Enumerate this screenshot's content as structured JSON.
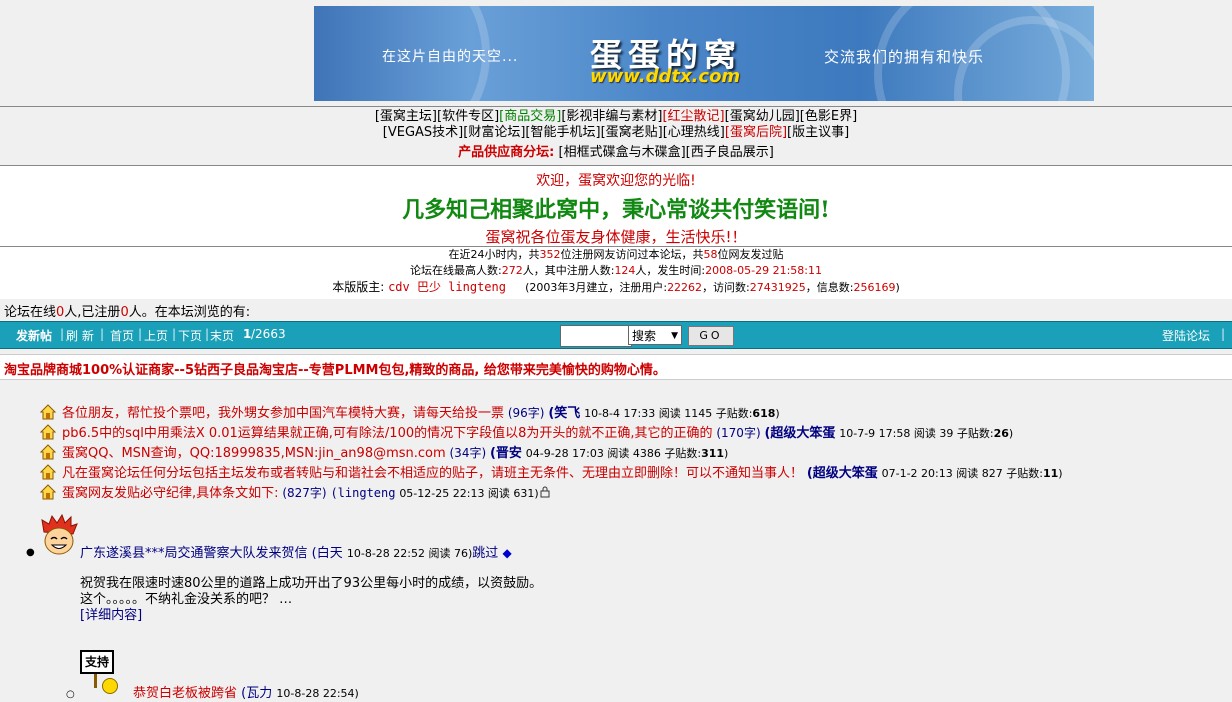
{
  "banner": {
    "left_slogan": "在这片自由的天空...",
    "logo_title": "蛋蛋的窝",
    "logo_url": "www.ddtx.com",
    "right_slogan": "交流我们的拥有和快乐"
  },
  "nav": {
    "row1": [
      "[蛋窝主坛]",
      "[软件专区]",
      "[商品交易]",
      "[影视非编与素材]",
      "[红尘散记]",
      "[蛋窝幼儿园]",
      "[色影E界]"
    ],
    "row2": [
      "[VEGAS技术]",
      "[财富论坛]",
      "[智能手机坛]",
      "[蛋窝老贴]",
      "[心理热线]",
      "[蛋窝后院]",
      "[版主议事]"
    ],
    "supplier_label": "产品供应商分坛:",
    "supplier_links": [
      "[相框式碟盒与木碟盒]",
      "[西子良品展示]"
    ]
  },
  "welcome": {
    "line1": "欢迎，蛋窝欢迎您的光临!",
    "line2": "几多知己相聚此窝中，秉心常谈共付笑语间!",
    "line3": "蛋窝祝各位蛋友身体健康，生活快乐!！"
  },
  "stats": {
    "l1_a": "在近24小时内，共",
    "l1_num1": "352",
    "l1_b": "位注册网友访问过本论坛，共",
    "l1_num2": "58",
    "l1_c": "位网友发过贴",
    "l2_a": "论坛在线最高人数:",
    "l2_num1": "272",
    "l2_b": "人，其中注册人数:",
    "l2_num2": "124",
    "l2_c": "人，发生时间:",
    "l2_time": "2008-05-29 21:58:11",
    "l3_label": "本版版主:",
    "moderators": "cdv 巴少 lingteng",
    "l3_info_a": "(2003年3月建立，注册用户:",
    "reg_users": "22262",
    "l3_info_b": "，访问数:",
    "visits": "27431925",
    "l3_info_c": "，信息数:",
    "messages": "256169",
    "l3_info_d": ")"
  },
  "online": {
    "a": "论坛在线",
    "num1": "0",
    "b": "人,已注册",
    "num2": "0",
    "c": "人。在本坛浏览的有:"
  },
  "toolbar": {
    "new_post": "发新帖",
    "refresh": "刷 新",
    "first": "首页",
    "prev": "上页",
    "next": "下页",
    "last": "末页",
    "page_current": "1",
    "page_total": "/2663",
    "search_placeholder": "",
    "search_select": "搜索",
    "go": "GO",
    "login": "登陆论坛"
  },
  "ad": {
    "text": "淘宝品牌商城100%认证商家--5钻西子良品淘宝店--专营PLMM包包,精致的商品, 给您带来完美愉快的购物心情。"
  },
  "pinned": [
    {
      "title": "各位朋友，帮忙投个票吧，我外甥女参加中国汽车模特大赛，请每天给投一票",
      "count": "(96字)",
      "author": "(笑飞",
      "meta": "10-8-4 17:33 阅读 1145 子贴数:",
      "replies": "618",
      "end": ")"
    },
    {
      "title": "pb6.5中的sql中用乘法X 0.01运算结果就正确,可有除法/100的情况下字段值以8为开头的就不正确,其它的正确的",
      "count": "(170字)",
      "author": "(超级大笨蛋",
      "meta": "10-7-9 17:58 阅读 39 子贴数:",
      "replies": "26",
      "end": ")"
    },
    {
      "title": "蛋窝QQ、MSN查询，QQ:18999835,MSN:jin_an98@msn.com",
      "count": "(34字)",
      "author": "(晋安",
      "meta": "04-9-28 17:03 阅读 4386 子贴数:",
      "replies": "311",
      "end": ")"
    },
    {
      "title": "凡在蛋窝论坛任何分坛包括主坛发布或者转贴与和谐社会不相适应的贴子，请班主无条件、无理由立即删除！可以不通知当事人！",
      "count": "",
      "author": "(超级大笨蛋",
      "meta": "07-1-2 20:13 阅读 827 子贴数:",
      "replies": "11",
      "end": ")"
    },
    {
      "title": "蛋窝网友发贴必守纪律,具体条文如下:",
      "count": "(827字)",
      "author": "(lingteng",
      "meta": "05-12-25 22:13 阅读 631)",
      "replies": "",
      "end": ""
    }
  ],
  "post": {
    "title": "广东遂溪县***局交通警察大队发来贺信",
    "author": "(白天",
    "meta": "10-8-28 22:52 阅读 76)",
    "jump": "跳过",
    "body_line1": "祝贺我在限速时速80公里的道路上成功开出了93公里每小时的成绩，以资鼓励。",
    "body_line2": "这个。。。。。不纳礼金没关系的吧？ …",
    "detail": "[详细内容]",
    "sign_text": "支持",
    "reply_title": "恭贺白老板被跨省",
    "reply_author": "(瓦力",
    "reply_meta": "10-8-28 22:54)"
  }
}
